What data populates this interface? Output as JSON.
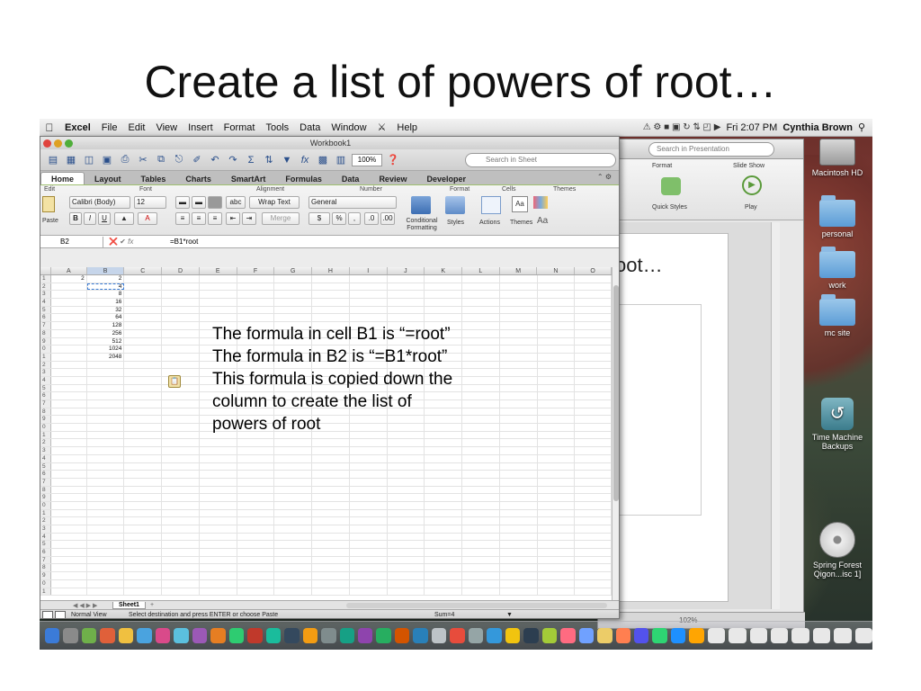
{
  "slide": {
    "title": "Create a list of powers of root…",
    "note_lines": [
      "The formula in cell B1 is “=root”",
      "The formula in B2 is “=B1*root”",
      "This formula is copied down the",
      "column to create the list of",
      "powers of root"
    ]
  },
  "menubar": {
    "app": "Excel",
    "items": [
      "File",
      "Edit",
      "View",
      "Insert",
      "Format",
      "Tools",
      "Data",
      "Window",
      "Help"
    ],
    "clock": "Fri 2:07 PM",
    "user": "Cynthia Brown"
  },
  "excel": {
    "window_title": "Workbook1",
    "zoom": "100%",
    "search_placeholder": "Search in Sheet",
    "tabs": [
      "Home",
      "Layout",
      "Tables",
      "Charts",
      "SmartArt",
      "Formulas",
      "Data",
      "Review",
      "Developer"
    ],
    "ribbon": {
      "groups": [
        "Edit",
        "Font",
        "Alignment",
        "Number",
        "Format",
        "Cells",
        "Themes"
      ],
      "paste": "Paste",
      "font_name": "Calibri (Body)",
      "font_size": "12",
      "wrap_text": "Wrap Text",
      "merge": "Merge",
      "number_format": "General",
      "conditional_formatting": "Conditional Formatting",
      "styles": "Styles",
      "actions": "Actions",
      "themes": "Themes"
    },
    "name_box": "B2",
    "formula": "=B1*root",
    "columns": [
      "A",
      "B",
      "C",
      "D",
      "E",
      "F",
      "G",
      "H",
      "I",
      "J",
      "K",
      "L",
      "M",
      "N",
      "O"
    ],
    "rows": [
      [
        "2",
        "2"
      ],
      [
        "",
        "4"
      ],
      [
        "",
        "8"
      ],
      [
        "",
        "16"
      ],
      [
        "",
        "32"
      ],
      [
        "",
        "64"
      ],
      [
        "",
        "128"
      ],
      [
        "",
        "256"
      ],
      [
        "",
        "512"
      ],
      [
        "",
        "1024"
      ],
      [
        "",
        "2048"
      ]
    ],
    "sheet_tab": "Sheet1",
    "status": {
      "view": "Normal View",
      "message": "Select destination and press ENTER or choose Paste",
      "sum": "Sum=4"
    }
  },
  "powerpoint": {
    "search_placeholder": "Search in Presentation",
    "ribbon_labels": [
      "Format",
      "Slide Show",
      "Quick Styles",
      "Play"
    ],
    "slide_text": "oot…",
    "status_zoom": "102%"
  },
  "desktop_icons": [
    {
      "label": "Macintosh HD",
      "icon": "hard-drive-icon"
    },
    {
      "label": "personal",
      "icon": "folder-icon"
    },
    {
      "label": "work",
      "icon": "folder-icon"
    },
    {
      "label": "mc site",
      "icon": "folder-icon"
    },
    {
      "label": "Time Machine Backups",
      "icon": "time-machine-icon"
    },
    {
      "label": "Spring Forest Qigon...isc 1]",
      "icon": "cd-icon"
    }
  ]
}
